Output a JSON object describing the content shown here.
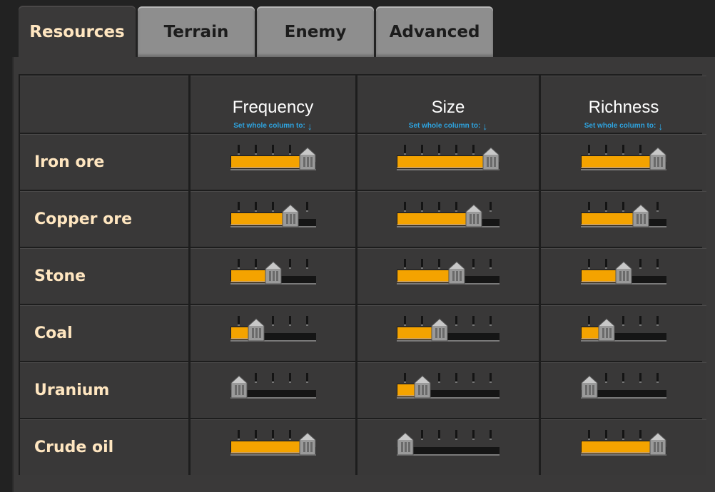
{
  "tabs": [
    {
      "label": "Resources",
      "active": true
    },
    {
      "label": "Terrain"
    },
    {
      "label": "Enemy"
    },
    {
      "label": "Advanced"
    }
  ],
  "columns": [
    {
      "title": "Frequency",
      "set_label": "Set whole column to:",
      "positions": 5
    },
    {
      "title": "Size",
      "set_label": "Set whole column to:",
      "positions": 6
    },
    {
      "title": "Richness",
      "set_label": "Set whole column to:",
      "positions": 5
    }
  ],
  "rows": [
    {
      "label": "Iron ore",
      "values": [
        4,
        5,
        4
      ]
    },
    {
      "label": "Copper ore",
      "values": [
        3,
        4,
        3
      ]
    },
    {
      "label": "Stone",
      "values": [
        2,
        3,
        2
      ]
    },
    {
      "label": "Coal",
      "values": [
        1,
        2,
        1
      ]
    },
    {
      "label": "Uranium",
      "values": [
        0,
        1,
        0
      ]
    },
    {
      "label": "Crude oil",
      "values": [
        4,
        0,
        4
      ]
    }
  ],
  "colors": {
    "accent": "#f4a300",
    "link": "#2ea4e0",
    "label": "#ffe6c0"
  }
}
